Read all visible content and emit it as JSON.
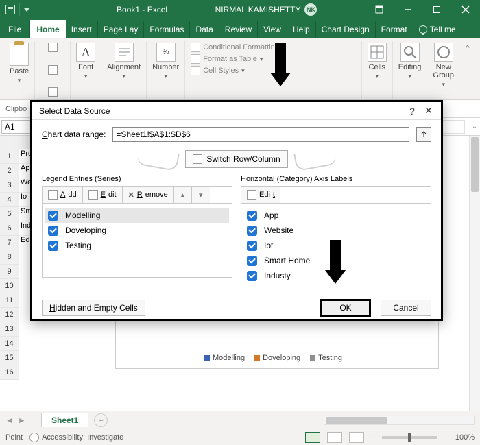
{
  "titlebar": {
    "doc": "Book1 - Excel",
    "user": "NIRMAL KAMISHETTY",
    "initials": "NK"
  },
  "tabs": {
    "file": "File",
    "home": "Home",
    "insert": "Insert",
    "pagelay": "Page Lay",
    "formulas": "Formulas",
    "data": "Data",
    "review": "Review",
    "view": "View",
    "help": "Help",
    "chartdesign": "Chart Design",
    "format": "Format",
    "tellme": "Tell me"
  },
  "ribbon": {
    "clipboard": {
      "label": "Clipbo",
      "paste": "Paste"
    },
    "font": {
      "label": "Font"
    },
    "alignment": {
      "label": "Alignment"
    },
    "number": {
      "label": "Number"
    },
    "styles": {
      "conditional": "Conditional Formatting",
      "table": "Format as Table",
      "cell": "Cell Styles"
    },
    "cells": {
      "label": "Cells"
    },
    "editing": {
      "label": "Editing"
    },
    "newgroup": {
      "label": "New\nGroup"
    }
  },
  "namebox": "A1",
  "sheet_rows": {
    "1": "Pro",
    "2": "Ap",
    "3": "We",
    "4": "Io",
    "5": "Sm",
    "6": "Ind",
    "7": "Ed"
  },
  "sheet_tab": "Sheet1",
  "status": {
    "mode": "Point",
    "access": "Accessibility: Investigate",
    "zoom": "100%"
  },
  "chart_legend": {
    "a": "Modelling",
    "b": "Doveloping",
    "c": "Testing",
    "color_a": "#3b62b3",
    "color_b": "#d37a2a",
    "color_c": "#8f8f8f"
  },
  "dialog": {
    "title": "Select Data Source",
    "range_label": "Chart data range:",
    "range_value": "=Sheet1!$A$1:$D$6",
    "switch": "Switch Row/Column",
    "series_title": "Legend Entries (Series)",
    "axis_title": "Horizontal (Category) Axis Labels",
    "btn_add": "Add",
    "btn_edit": "Edit",
    "btn_remove": "Remove",
    "series": [
      "Modelling",
      "Doveloping",
      "Testing"
    ],
    "categories": [
      "App",
      "Website",
      "Iot",
      "Smart Home",
      "Industy"
    ],
    "hidden": "Hidden and Empty Cells",
    "ok": "OK",
    "cancel": "Cancel"
  }
}
